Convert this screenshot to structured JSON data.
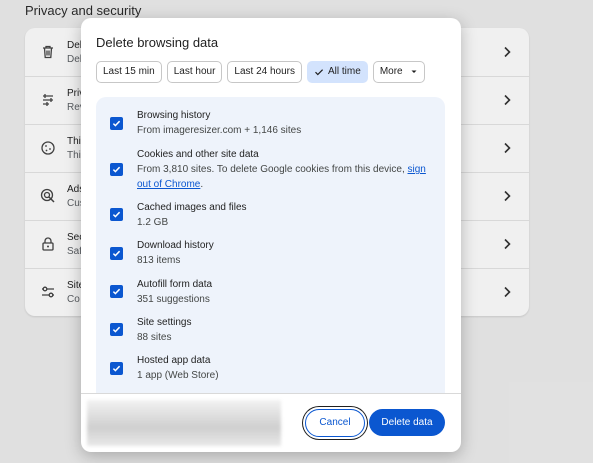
{
  "background": {
    "section_title": "Privacy and security",
    "rows": [
      {
        "icon": "trash-icon",
        "title": "Del",
        "sub": "Del"
      },
      {
        "icon": "privacy-guide-icon",
        "title": "Priv",
        "sub": "Rev"
      },
      {
        "icon": "cookie-icon",
        "title": "Thi",
        "sub": "Thi"
      },
      {
        "icon": "ad-privacy-icon",
        "title": "Ads",
        "sub": "Cus"
      },
      {
        "icon": "lock-icon",
        "title": "Sec",
        "sub": "Saf"
      },
      {
        "icon": "sliders-icon",
        "title": "Site",
        "sub": "Co"
      }
    ]
  },
  "dialog": {
    "title": "Delete browsing data",
    "time_ranges": [
      {
        "label": "Last 15 min",
        "selected": false
      },
      {
        "label": "Last hour",
        "selected": false
      },
      {
        "label": "Last 24 hours",
        "selected": false
      },
      {
        "label": "All time",
        "selected": true
      }
    ],
    "more_label": "More",
    "items": [
      {
        "label": "Browsing history",
        "desc": "From imageresizer.com + 1,146 sites",
        "checked": true
      },
      {
        "label": "Cookies and other site data",
        "desc": "From 3,810 sites. To delete Google cookies from this device, ",
        "link": "sign out of Chrome",
        "desc_end": ".",
        "checked": true
      },
      {
        "label": "Cached images and files",
        "desc": "1.2 GB",
        "checked": true
      },
      {
        "label": "Download history",
        "desc": "813 items",
        "checked": true
      },
      {
        "label": "Autofill form data",
        "desc": "351 suggestions",
        "checked": true
      },
      {
        "label": "Site settings",
        "desc": "88 sites",
        "checked": true
      },
      {
        "label": "Hosted app data",
        "desc": "1 app (Web Store)",
        "checked": true
      }
    ],
    "cancel_label": "Cancel",
    "delete_label": "Delete data"
  },
  "colors": {
    "accent": "#0b57d0",
    "selected_chip": "#d3e3fd",
    "list_bg": "#eef3fb"
  }
}
